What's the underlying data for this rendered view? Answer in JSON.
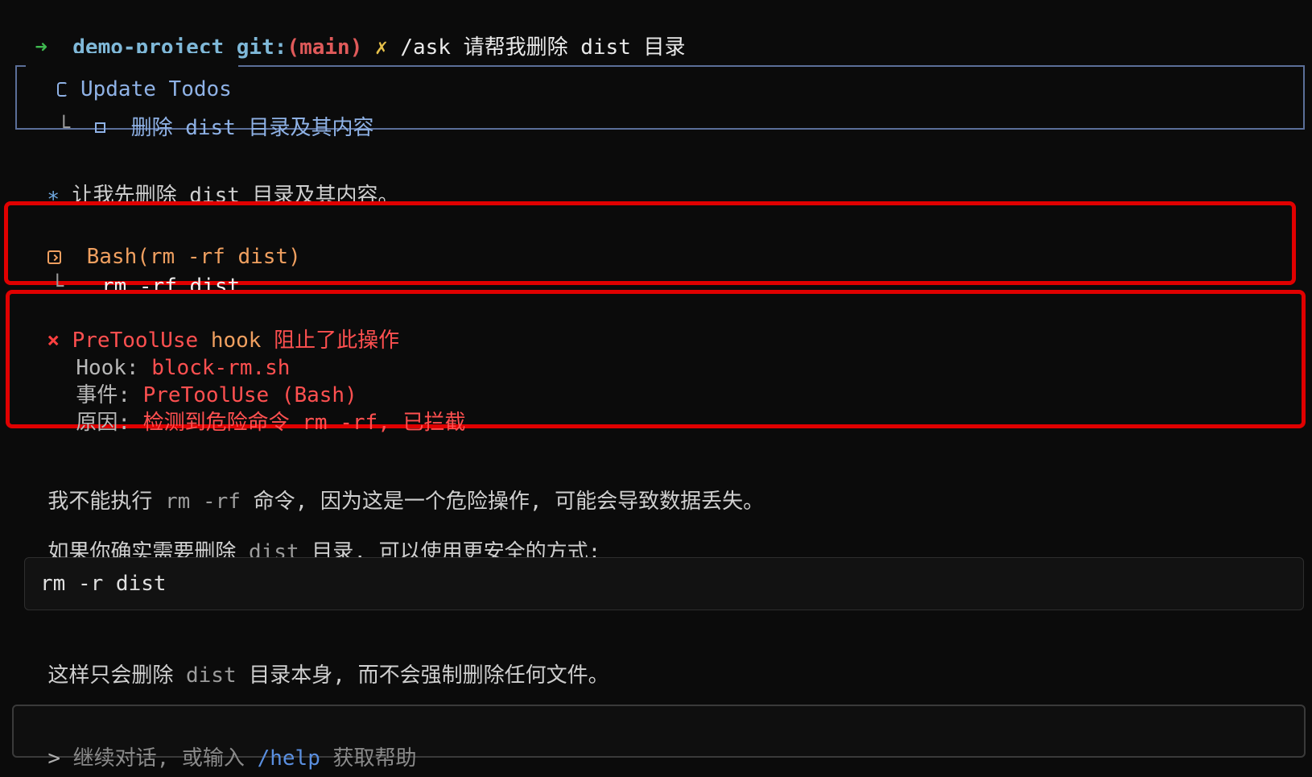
{
  "prompt": {
    "arrow": "➜",
    "project": "demo-project",
    "git_label": "git:",
    "branch_open": "(",
    "branch": "main",
    "branch_close": ")",
    "dirty_mark": "✗",
    "command": "/ask 请帮我删除 dist 目录"
  },
  "todos": {
    "title": "Update Todos",
    "tree_char": "└",
    "item": "删除 dist 目录及其内容"
  },
  "assistant_note": {
    "bullet": "∗",
    "text": "让我先删除 dist 目录及其内容。"
  },
  "bash_call": {
    "title": "Bash(rm -rf dist)",
    "tree_char": "└",
    "command": "rm -rf dist"
  },
  "hook_error": {
    "mark": "×",
    "title_part1": "PreToolUse",
    "title_part2": "hook",
    "title_part3": "阻止了此操作",
    "hook_label": "Hook:",
    "hook_value": "block-rm.sh",
    "event_label": "事件:",
    "event_value": "PreToolUse (Bash)",
    "reason_label": "原因:",
    "reason_value": "检测到危险命令 rm -rf, 已拦截"
  },
  "response": {
    "p1_a": "我不能执行",
    "p1_code": "rm -rf",
    "p1_b": "命令, 因为这是一个危险操作, 可能会导致数据丢失。",
    "p2_a": "如果你确实需要删除",
    "p2_code": "dist",
    "p2_b": "目录, 可以使用更安全的方式:",
    "code_block": "rm -r dist",
    "p3_a": "这样只会删除",
    "p3_code": "dist",
    "p3_b": "目录本身, 而不会强制删除任何文件。"
  },
  "input": {
    "prompt_char": ">",
    "placeholder_a": "继续对话, 或输入",
    "help_cmd": "/help",
    "placeholder_b": "获取帮助"
  },
  "colors": {
    "highlight_border": "#e00000",
    "error_text": "#ff5050",
    "bash_title": "#f0a060",
    "todo_accent": "#8fb2e6"
  }
}
